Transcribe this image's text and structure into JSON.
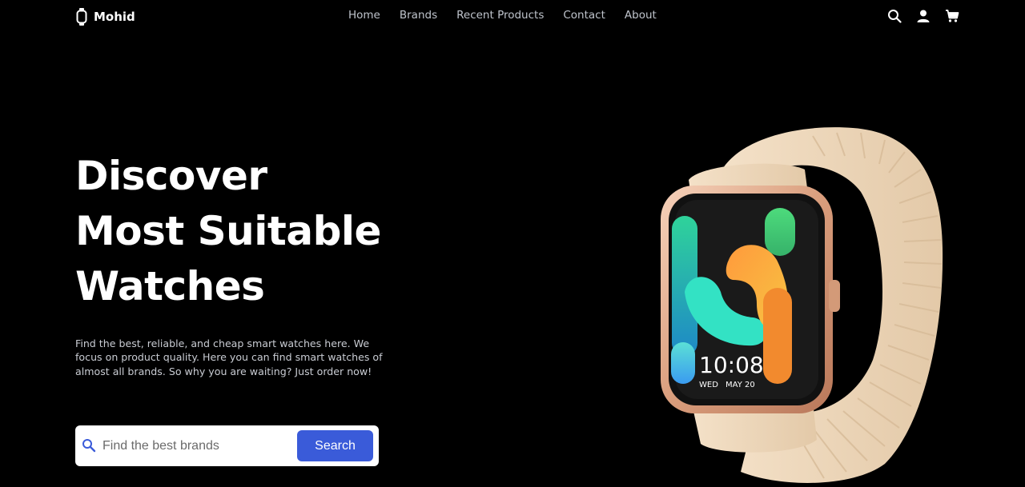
{
  "brand": {
    "name": "Mohid",
    "icon": "watch-icon"
  },
  "nav": {
    "links": [
      "Home",
      "Brands",
      "Recent Products",
      "Contact",
      "About"
    ],
    "icons": [
      "search-icon",
      "user-icon",
      "cart-icon"
    ]
  },
  "hero": {
    "title_lines": [
      "Discover",
      "Most Suitable",
      "Watches"
    ],
    "description": "Find the best, reliable, and cheap smart watches here. We focus on product quality. Here you can find smart watches of almost all brands. So why you are waiting? Just order now!"
  },
  "search": {
    "placeholder": "Find the best brands",
    "button_label": "Search"
  },
  "watch_display": {
    "time": "10:08",
    "day": "WED",
    "date": "MAY 20"
  },
  "colors": {
    "background": "#000000",
    "accent": "#3a5bd9",
    "nav_text": "#bfc4cc",
    "strap": "#efd9be",
    "case": "#e6b89a"
  }
}
